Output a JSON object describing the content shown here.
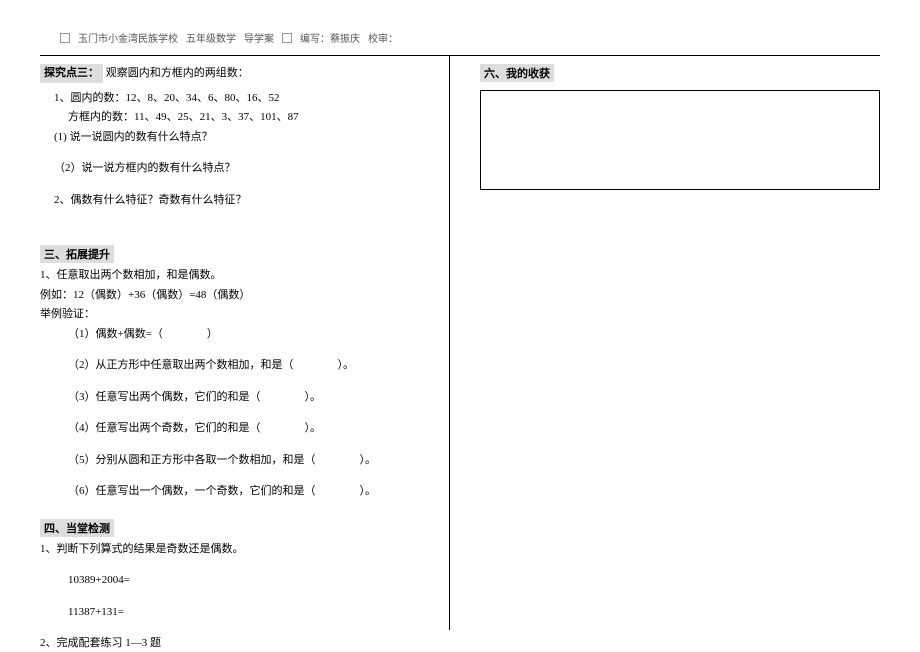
{
  "header": {
    "school": "玉门市小金湾民族学校",
    "grade": "五年级数学",
    "doc": "导学案",
    "author_label": "编写：蔡振庆",
    "review_label": "校审："
  },
  "s_explore": {
    "title": "探究点三：",
    "intro": "观察圆内和方框内的两组数：",
    "item1": "1、圆内的数：12、8、20、34、6、80、16、52",
    "item_box": "方框内的数：11、49、25、21、3、37、101、87",
    "q1": "(1) 说一说圆内的数有什么特点？",
    "q2": "（2）说一说方框内的数有什么特点？",
    "q3": "2、偶数有什么特征？奇数有什么特征？"
  },
  "s_expand": {
    "title": "三、拓展提升",
    "l1": "1、任意取出两个数相加，和是偶数。",
    "l2": "例如：12（偶数）+36（偶数）=48（偶数）",
    "l3": "举例验证：",
    "i1": "（1）偶数+偶数=（　　　　）",
    "i2": "（2）从正方形中任意取出两个数相加，和是（　　　　）。",
    "i3": "（3）任意写出两个偶数，它们的和是（　　　　）。",
    "i4": "（4）任意写出两个奇数，它们的和是（　　　　）。",
    "i5": "（5）分别从圆和正方形中各取一个数相加，和是（　　　　）。",
    "i6": "（6）任意写出一个偶数，一个奇数，它们的和是（　　　　）。"
  },
  "s_test": {
    "title": "四、当堂检测",
    "l1": "1、判断下列算式的结果是奇数还是偶数。",
    "e1": "10389+2004=",
    "e2": "11387+131=",
    "l2": "2、完成配套练习 1—3 题"
  },
  "s_harvest": {
    "title": "六、我的收获"
  }
}
